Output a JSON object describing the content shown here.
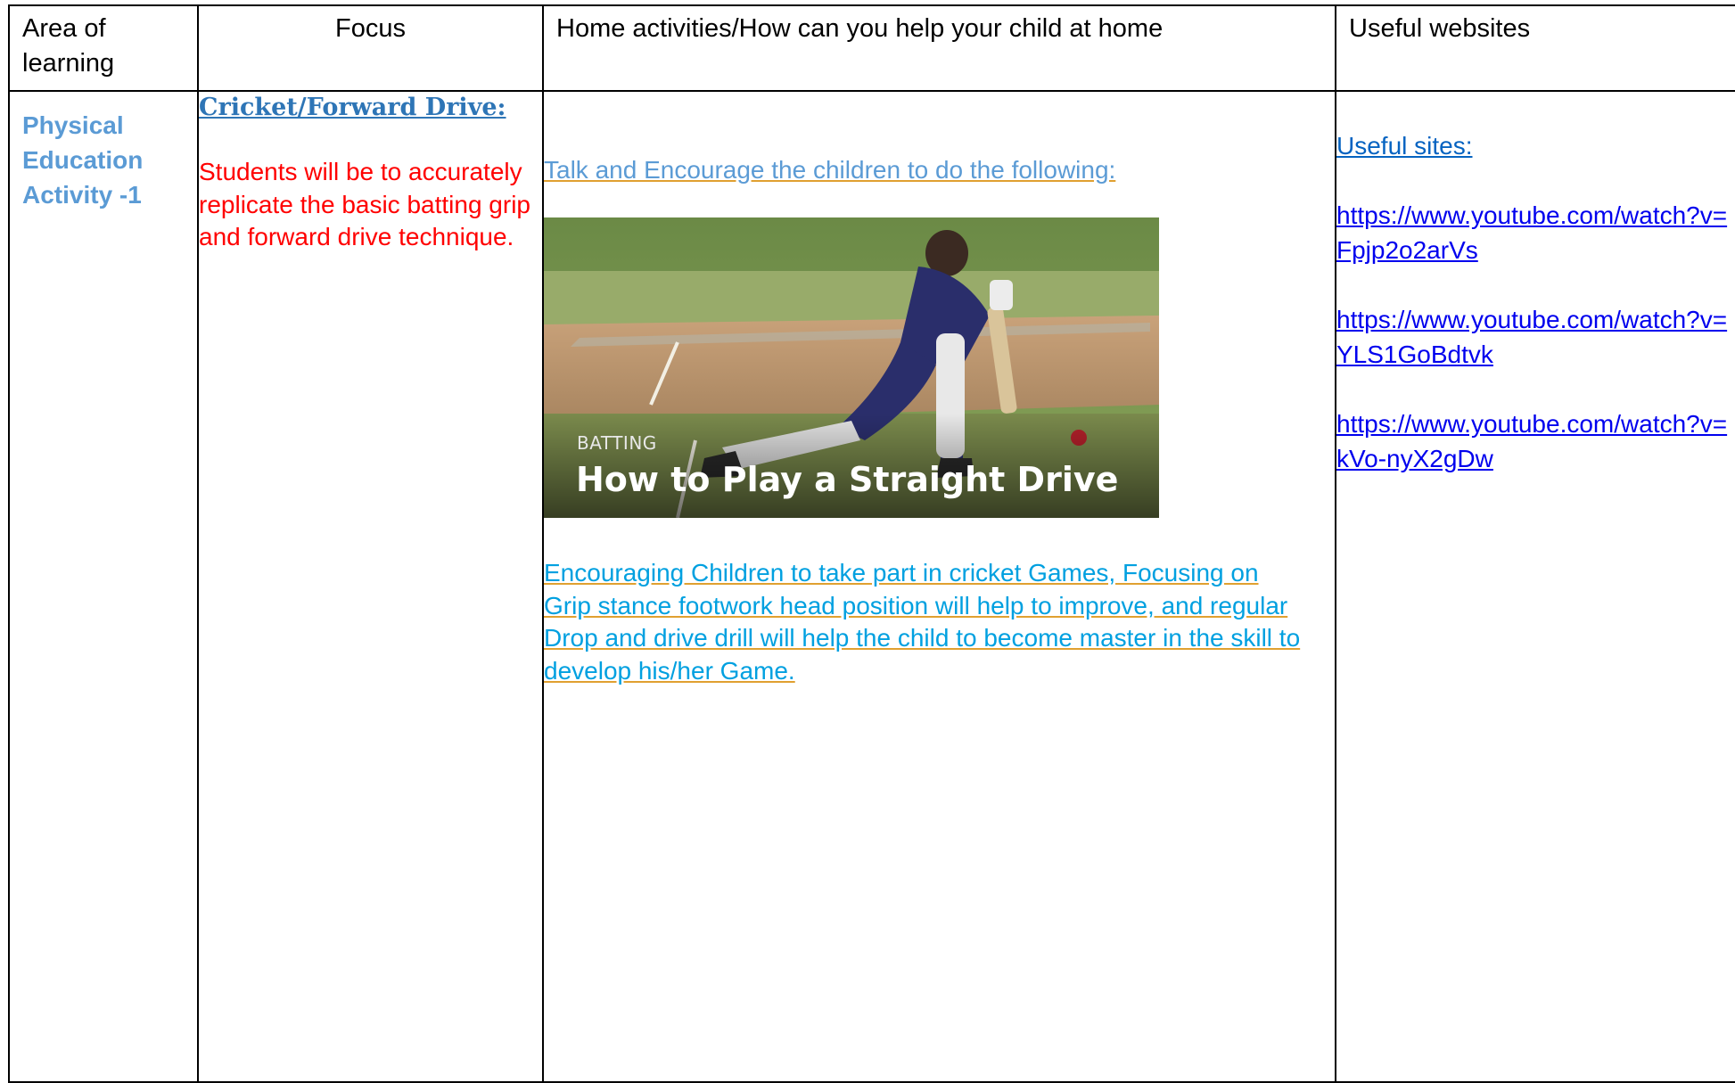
{
  "table": {
    "headers": {
      "area": "Area of learning",
      "focus": "Focus",
      "home": "Home activities/How can you help your child at home",
      "websites": "Useful websites"
    },
    "row": {
      "area": "Physical Education Activity -1",
      "focus_title": "Cricket/Forward Drive:",
      "focus_description": "Students will be to accurately replicate the basic batting grip and forward drive technique.",
      "talk_text": "Talk and Encourage the children to do the following:",
      "image": {
        "caption_small": "BATTING",
        "caption_large": "How to Play a Straight Drive"
      },
      "encourage_text": "Encouraging Children to take part in cricket Games, Focusing on Grip stance footwork head position will help to improve, and regular Drop and drive drill will help the child to become master in the skill to develop his/her Game.",
      "websites_label": "Useful sites:",
      "links": [
        "https://www.youtube.com/watch?v=Fpjp2o2arVs",
        "https://www.youtube.com/watch?v=YLS1GoBdtvk",
        "https://www.youtube.com/watch?v=kVo-nyX2gDw"
      ]
    }
  },
  "colors": {
    "area_text": "#5b9bd5",
    "focus_title": "#2e75b6",
    "focus_description": "#ff0000",
    "talk_text": "#5b9bd5",
    "encourage_text": "#00a0e0",
    "link": "#0000ee"
  }
}
